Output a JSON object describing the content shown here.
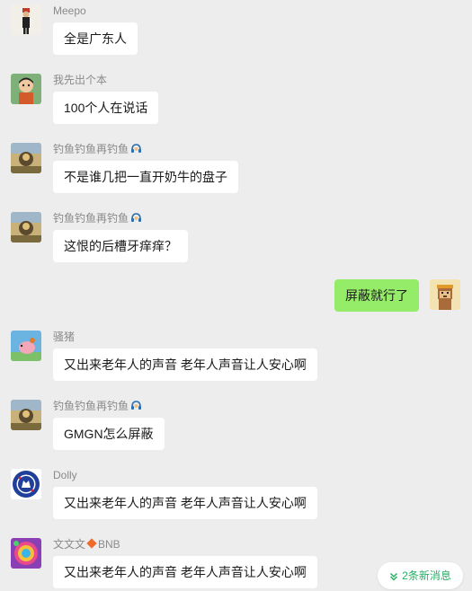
{
  "messages": [
    {
      "sender": "Meepo",
      "text": "全是广东人",
      "avatar": "meepo-avatar"
    },
    {
      "sender": "我先出个本",
      "text": "100个人在说话",
      "avatar": "cartoon-boy-avatar"
    },
    {
      "sender": "钓鱼钓鱼再钓鱼",
      "text": "不是谁几把一直开奶牛的盘子",
      "avatar": "landscape-avatar"
    },
    {
      "sender": "钓鱼钓鱼再钓鱼",
      "text": "这恨的后槽牙痒痒？",
      "avatar": "landscape-avatar"
    },
    {
      "sender": "",
      "text": "屏蔽就行了",
      "avatar": "pixel-monkey-avatar",
      "self": true
    },
    {
      "sender": "骚猪",
      "text": "又出来老年人的声音 老年人声音让人安心啊",
      "avatar": "pig-avatar"
    },
    {
      "sender": "钓鱼钓鱼再钓鱼",
      "text": "GMGN怎么屏蔽",
      "avatar": "landscape-avatar"
    },
    {
      "sender": "Dolly",
      "text": "又出来老年人的声音 老年人声音让人安心啊",
      "avatar": "chelsea-badge-avatar"
    },
    {
      "sender_prefix": "文文文",
      "sender_suffix": "BNB",
      "text": "又出来老年人的声音 老年人声音让人安心啊",
      "avatar": "colorful-avatar"
    }
  ],
  "new_messages_label": "2条新消息",
  "colors": {
    "background": "#ededed",
    "bubble_other": "#ffffff",
    "bubble_self": "#95ec69",
    "accent_green": "#2aae67"
  }
}
